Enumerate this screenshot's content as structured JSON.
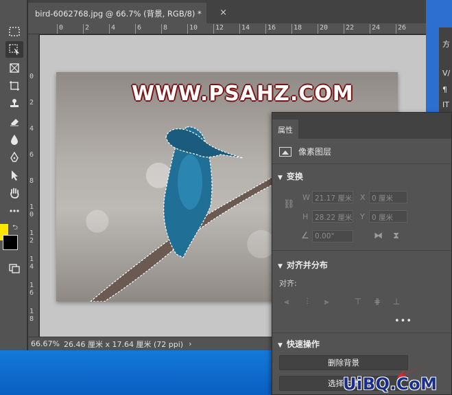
{
  "document": {
    "tab_title": "bird-6062768.jpg @ 66.7% (背景, RGB/8) *",
    "close_glyph": "×"
  },
  "rulers": {
    "horizontal": [
      "0",
      "2",
      "4",
      "6",
      "8",
      "10",
      "12",
      "14",
      "16",
      "18",
      "20",
      "22",
      "24",
      "26"
    ],
    "vertical": [
      "0",
      "2",
      "4",
      "6",
      "8",
      "1 0",
      "1 2",
      "1 4",
      "1 6",
      "1 8"
    ]
  },
  "image_watermark": "WWW.PSAHZ.COM",
  "status": {
    "zoom": "66.67%",
    "doc_size": "26.46 厘米 x 17.64 厘米 (72 ppi)",
    "chevron": "›"
  },
  "dock": {
    "labels": [
      "方",
      "V/",
      "¶",
      "IT"
    ]
  },
  "properties": {
    "tab_label": "属性",
    "layer_type": "像素图层",
    "transform": {
      "title": "变换",
      "w_label": "W",
      "w_value": "21.17 厘米",
      "x_label": "X",
      "x_value": "0 厘米",
      "h_label": "H",
      "h_value": "28.22 厘米",
      "y_label": "Y",
      "y_value": "0 厘米",
      "angle_value": "0.00°"
    },
    "align": {
      "title": "对齐并分布",
      "align_label": "对齐:",
      "more": "•••"
    },
    "quick_actions": {
      "title": "快速操作",
      "remove_bg": "删除背景",
      "select_subject": "选择主体"
    }
  },
  "site_mark": "UiBQ.CoM",
  "colors": {
    "foreground": "#ffe600",
    "background": "#000000",
    "taskbar": "#1479d9"
  }
}
